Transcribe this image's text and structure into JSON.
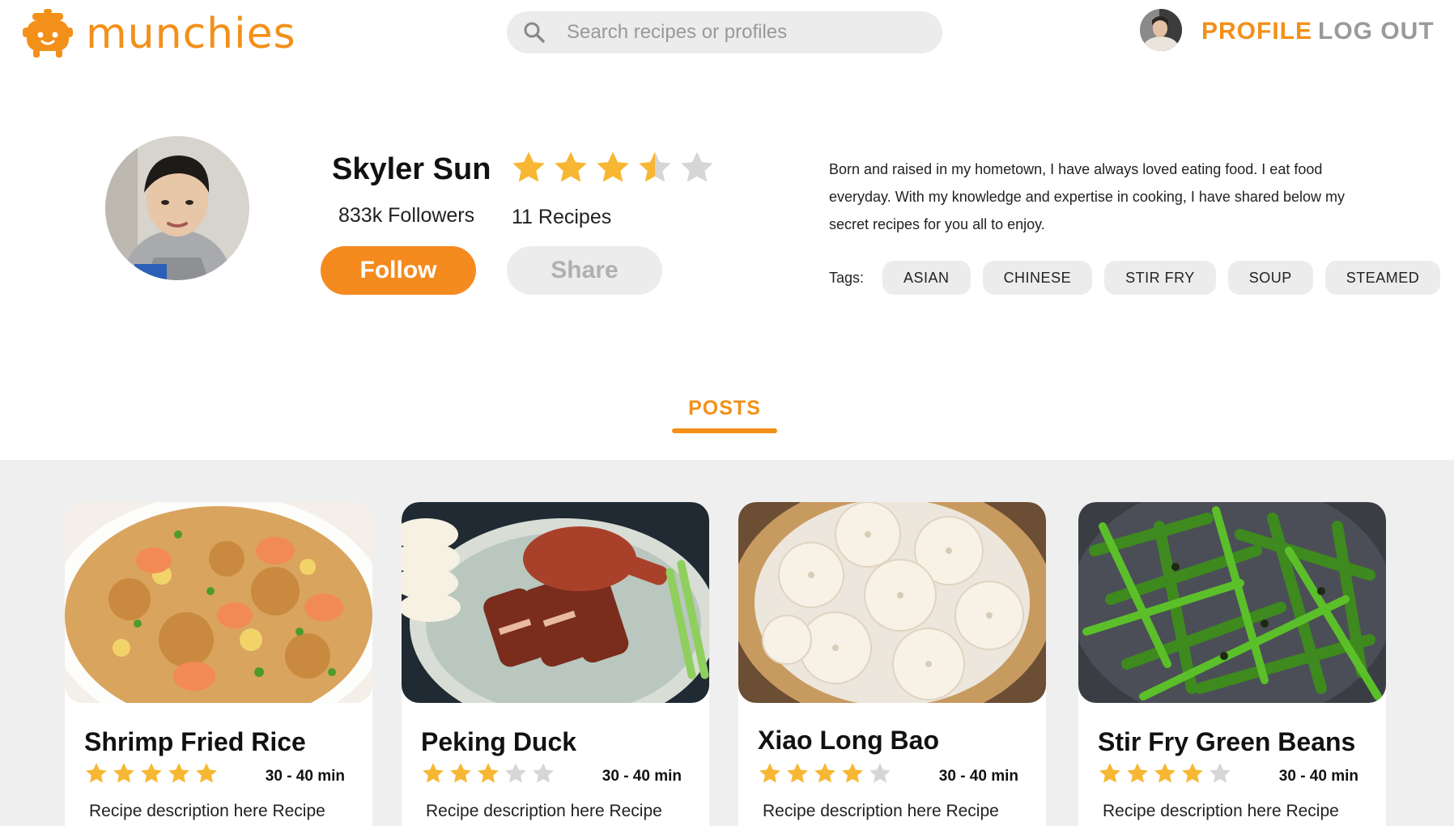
{
  "brand": {
    "name": "munchies",
    "color": "#F39019"
  },
  "search": {
    "placeholder": "Search recipes or profiles"
  },
  "nav": {
    "profile_label": "PROFILE",
    "logout_label": "LOG OUT"
  },
  "profile": {
    "name": "Skyler Sun",
    "rating": 3.5,
    "rating_max": 5,
    "followers": "833k Followers",
    "recipes": "11 Recipes",
    "follow_label": "Follow",
    "share_label": "Share",
    "bio": "Born and raised in my hometown, I have always loved eating food. I eat food everyday. With my knowledge and expertise in cooking, I have shared below my secret recipes for you all to enjoy.",
    "tags_label": "Tags:",
    "tags": [
      "ASIAN",
      "CHINESE",
      "STIR FRY",
      "SOUP",
      "STEAMED"
    ]
  },
  "tabs": {
    "posts_label": "POSTS"
  },
  "posts": [
    {
      "title": "Shrimp Fried Rice",
      "rating": 5,
      "time": "30 - 40 min",
      "description": "Recipe description here Recipe",
      "image": "shrimp-fried-rice-photo"
    },
    {
      "title": "Peking Duck",
      "rating": 3,
      "time": "30 - 40 min",
      "description": "Recipe description here Recipe",
      "image": "peking-duck-photo"
    },
    {
      "title": "Xiao Long Bao",
      "rating": 4,
      "time": "30 - 40 min",
      "description": "Recipe description here Recipe",
      "image": "xiao-long-bao-photo"
    },
    {
      "title": "Stir Fry Green Beans",
      "rating": 4,
      "time": "30 - 40 min",
      "description": "Recipe description here Recipe",
      "image": "green-beans-photo"
    }
  ],
  "colors": {
    "accent": "#F39019",
    "star_filled": "#F7B733",
    "star_empty": "#d6d6d6",
    "button_secondary": "#ececec"
  }
}
